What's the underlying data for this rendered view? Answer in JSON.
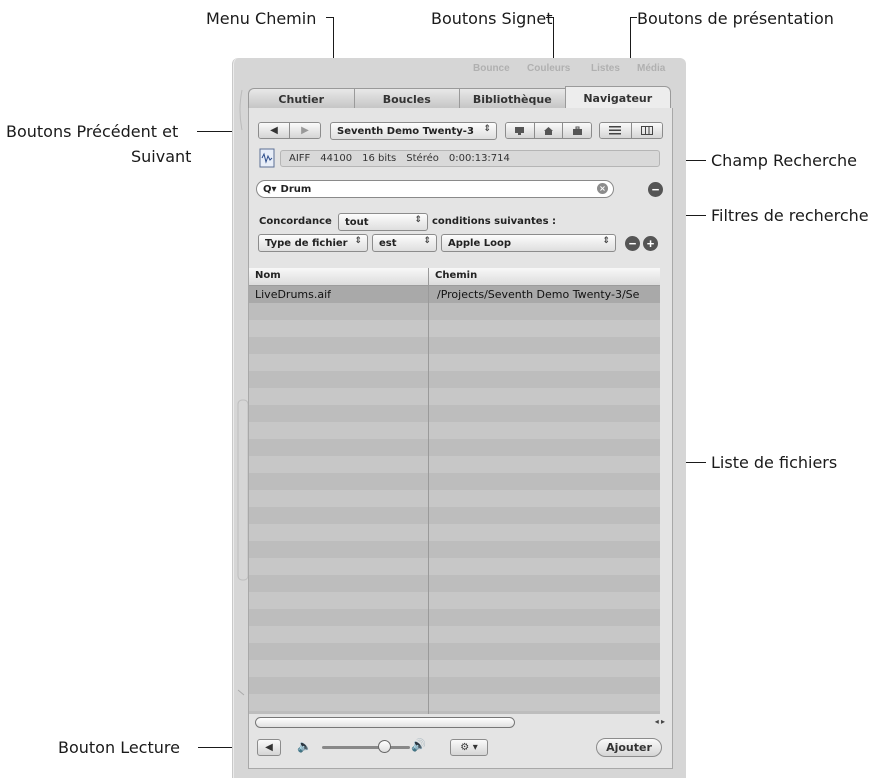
{
  "callouts": {
    "menu_chemin": "Menu Chemin",
    "boutons_signet": "Boutons Signet",
    "boutons_presentation": "Boutons de présentation",
    "prec_suivant_1": "Boutons Précédent et",
    "prec_suivant_2": "Suivant",
    "champ_recherche": "Champ Recherche",
    "filtres": "Filtres de recherche",
    "liste_fichiers": "Liste de fichiers",
    "bouton_lecture": "Bouton Lecture"
  },
  "top_hints": [
    "Bounce",
    "Couleurs",
    "Listes",
    "Média"
  ],
  "tabs": [
    {
      "label": "Chutier",
      "active": false
    },
    {
      "label": "Boucles",
      "active": false
    },
    {
      "label": "Bibliothèque",
      "active": false
    },
    {
      "label": "Navigateur",
      "active": true
    }
  ],
  "nav": {
    "back_icon": "back-arrow-icon",
    "forward_icon": "forward-arrow-icon",
    "path_menu": "Seventh Demo Twenty-3",
    "bookmark_icons": [
      "computer-icon",
      "home-icon",
      "briefcase-icon"
    ],
    "view_icons": [
      "list-view-icon",
      "column-view-icon"
    ]
  },
  "info": {
    "format": "AIFF",
    "rate": "44100",
    "bits": "16 bits",
    "channels": "Stéréo",
    "duration": "0:00:13:714"
  },
  "search": {
    "value": "Drum"
  },
  "filters": {
    "concordance_label": "Concordance",
    "concordance_value": "tout",
    "conditions_label": "conditions suivantes :",
    "field": "Type de fichier",
    "operator": "est",
    "value": "Apple Loop"
  },
  "table": {
    "col_name": "Nom",
    "col_path": "Chemin",
    "rows": [
      {
        "name": "LiveDrums.aif",
        "path": "/Projects/Seventh Demo Twenty-3/Se"
      }
    ]
  },
  "bottom": {
    "add_label": "Ajouter"
  }
}
